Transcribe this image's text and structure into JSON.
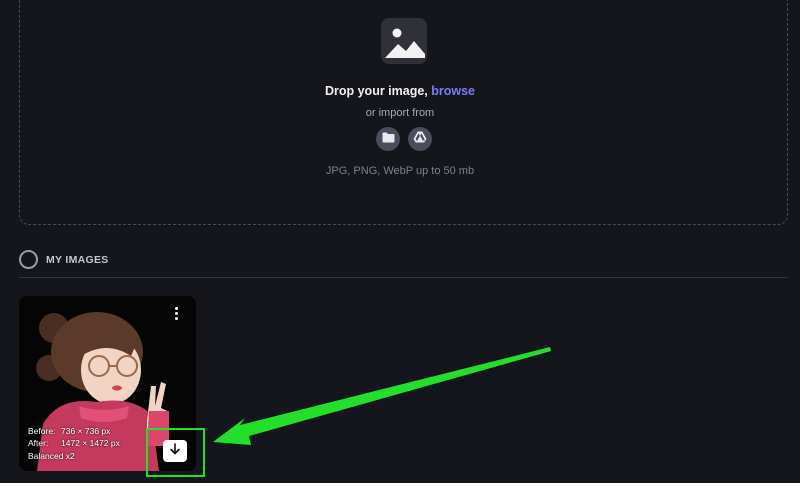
{
  "upload": {
    "drop_text": "Drop your image,",
    "browse_label": "browse",
    "import_text": "or import from",
    "import_sources": [
      "folder-icon",
      "google-drive-icon"
    ],
    "formats_text": "JPG, PNG, WebP up to 50 mb"
  },
  "images_section": {
    "title": "MY IMAGES"
  },
  "image_card": {
    "before_label": "Before:",
    "before_value": "736 × 736 px",
    "after_label": "After:",
    "after_value": "1472 × 1472 px",
    "mode": "Balanced x2",
    "menu_icon": "kebab-menu-icon",
    "download_icon": "download-icon"
  },
  "colors": {
    "background": "#15161b",
    "accent_link": "#7b7cf5",
    "annotation_green": "#22e02a"
  }
}
